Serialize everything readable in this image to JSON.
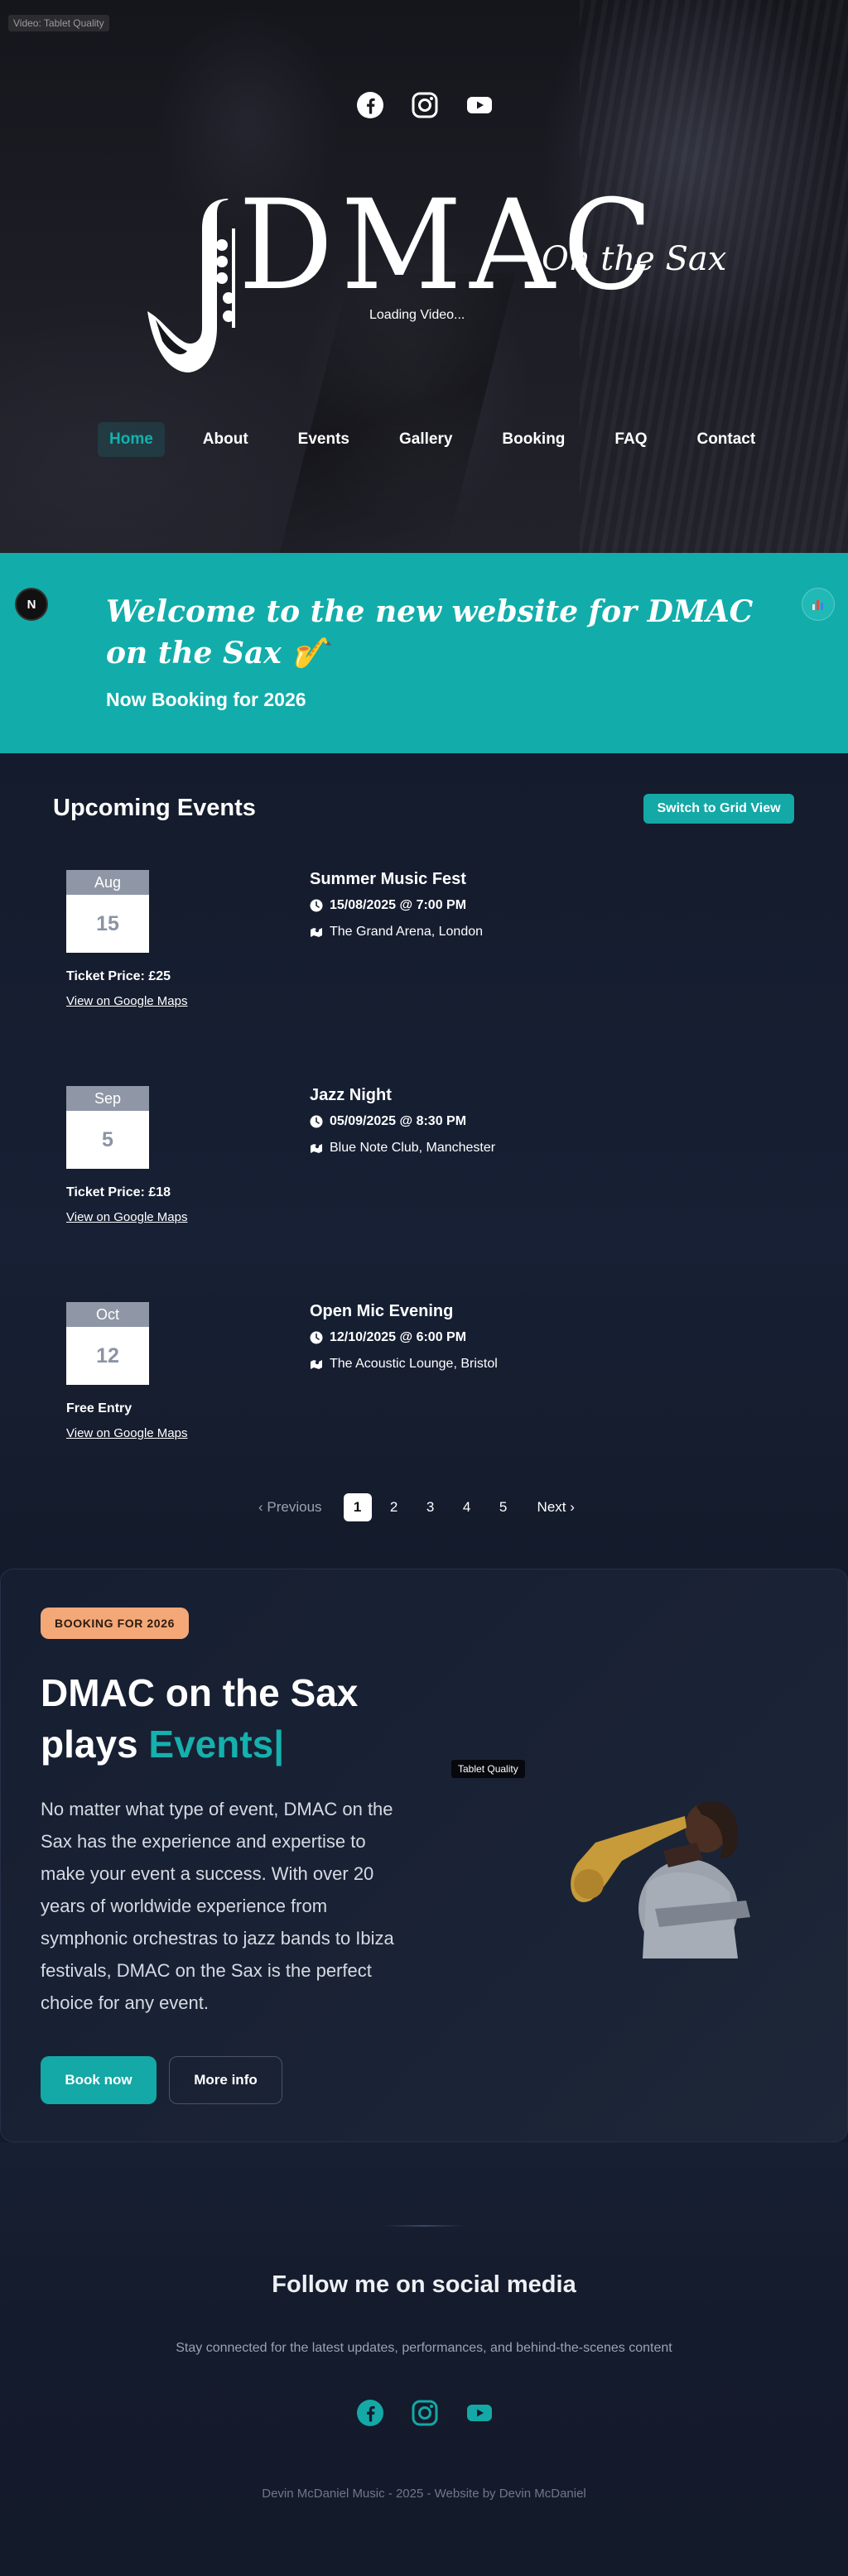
{
  "hero": {
    "video_badge": "Video: Tablet Quality",
    "social_icons": [
      "facebook-icon",
      "instagram-icon",
      "youtube-icon"
    ],
    "logo_main": "DMAC",
    "logo_sub": "On the Sax",
    "loading_text": "Loading Video..."
  },
  "nav": {
    "items": [
      {
        "label": "Home",
        "active": true
      },
      {
        "label": "About"
      },
      {
        "label": "Events"
      },
      {
        "label": "Gallery"
      },
      {
        "label": "Booking"
      },
      {
        "label": "FAQ"
      },
      {
        "label": "Contact"
      }
    ]
  },
  "banner": {
    "n_badge": "N",
    "welcome": "Welcome to the new website for DMAC on the Sax 🎷",
    "subheading": "Now Booking for 2026",
    "accent_color": "#12adaa"
  },
  "events": {
    "title": "Upcoming Events",
    "toggle_label": "Switch to Grid View",
    "items": [
      {
        "month": "Aug",
        "day": "15",
        "title": "Summer Music Fest",
        "datetime": "15/08/2025 @ 7:00 PM",
        "venue": "The Grand Arena, London",
        "price": "Ticket Price: £25",
        "maps": "View on Google Maps"
      },
      {
        "month": "Sep",
        "day": "5",
        "title": "Jazz Night",
        "datetime": "05/09/2025 @ 8:30 PM",
        "venue": "Blue Note Club, Manchester",
        "price": "Ticket Price: £18",
        "maps": "View on Google Maps"
      },
      {
        "month": "Oct",
        "day": "12",
        "title": "Open Mic Evening",
        "datetime": "12/10/2025 @ 6:00 PM",
        "venue": "The Acoustic Lounge, Bristol",
        "price": "Free Entry",
        "maps": "View on Google Maps"
      }
    ],
    "pagination": {
      "prev": "Previous",
      "pages": [
        "1",
        "2",
        "3",
        "4",
        "5"
      ],
      "current": "1",
      "next": "Next"
    }
  },
  "booking": {
    "pill": "BOOKING FOR 2026",
    "heading_line1": "DMAC on the Sax",
    "heading_line2_prefix": "plays",
    "heading_accent": "Events|",
    "paragraph": "No matter what type of event, DMAC on the Sax has the experience and expertise to make your event a success. With over 20 years of worldwide experience from symphonic orchestras to jazz bands to Ibiza festivals, DMAC on the Sax is the perfect choice for any event.",
    "book_button": "Book now",
    "info_button": "More info",
    "quality_badge": "Tablet Quality"
  },
  "footer": {
    "follow": "Follow me on social media",
    "tagline": "Stay connected for the latest updates, performances, and behind-the-scenes content",
    "social_icons": [
      "facebook-icon",
      "instagram-icon",
      "youtube-icon"
    ],
    "credit": "Devin McDaniel Music - 2025 - Website by Devin McDaniel"
  }
}
